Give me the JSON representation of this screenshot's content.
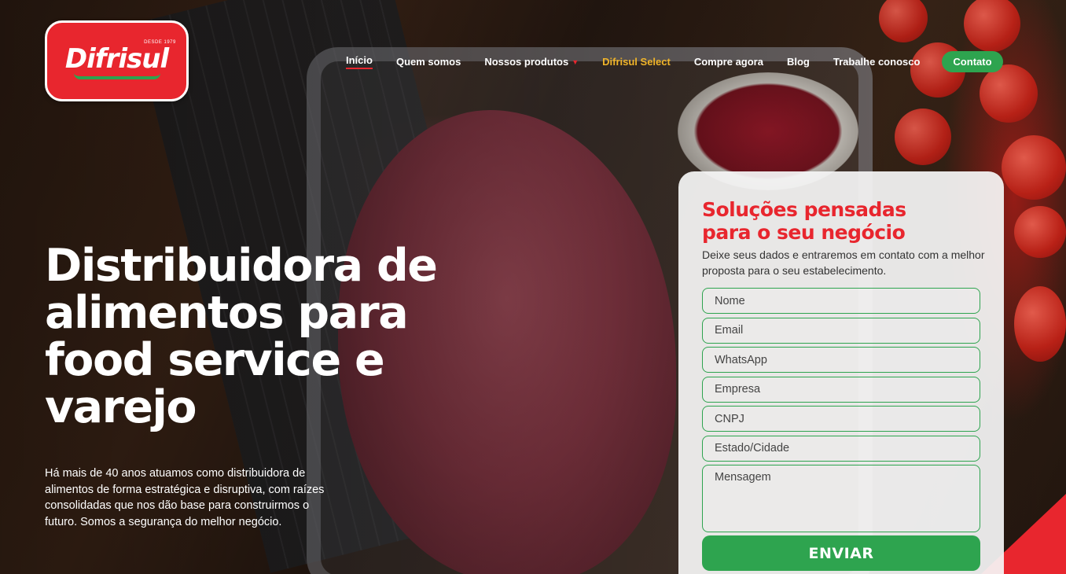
{
  "brand": {
    "logo_text": "Difrisul",
    "logo_since": "DESDE 1979"
  },
  "nav": {
    "items": [
      {
        "label": "Início",
        "active": true
      },
      {
        "label": "Quem somos"
      },
      {
        "label": "Nossos produtos",
        "has_dropdown": true
      },
      {
        "label": "Difrisul Select",
        "highlight_color": "#f0b429"
      },
      {
        "label": "Compre agora"
      },
      {
        "label": "Blog"
      },
      {
        "label": "Trabalhe conosco"
      }
    ],
    "contact_button": "Contato",
    "dropdown_icon": "chevron-down-icon"
  },
  "hero": {
    "title": "Distribuidora de alimentos para food service e varejo",
    "description": "Há mais de 40 anos atuamos como distribuidora de alimentos de forma estratégica e disruptiva, com raízes consolidadas que nos dão base para construirmos o futuro. Somos a segurança do melhor negócio."
  },
  "form": {
    "title": "Soluções pensadas para o seu negócio",
    "subtitle": "Deixe seus dados e entraremos em contato com a melhor proposta para o seu estabelecimento.",
    "fields": {
      "nome": "Nome",
      "email": "Email",
      "whatsapp": "WhatsApp",
      "empresa": "Empresa",
      "cnpj": "CNPJ",
      "estado_cidade": "Estado/Cidade",
      "mensagem": "Mensagem"
    },
    "submit_label": "ENVIAR"
  },
  "colors": {
    "brand_red": "#e8262e",
    "brand_green": "#2ea44f",
    "select_gold": "#f0b429"
  }
}
